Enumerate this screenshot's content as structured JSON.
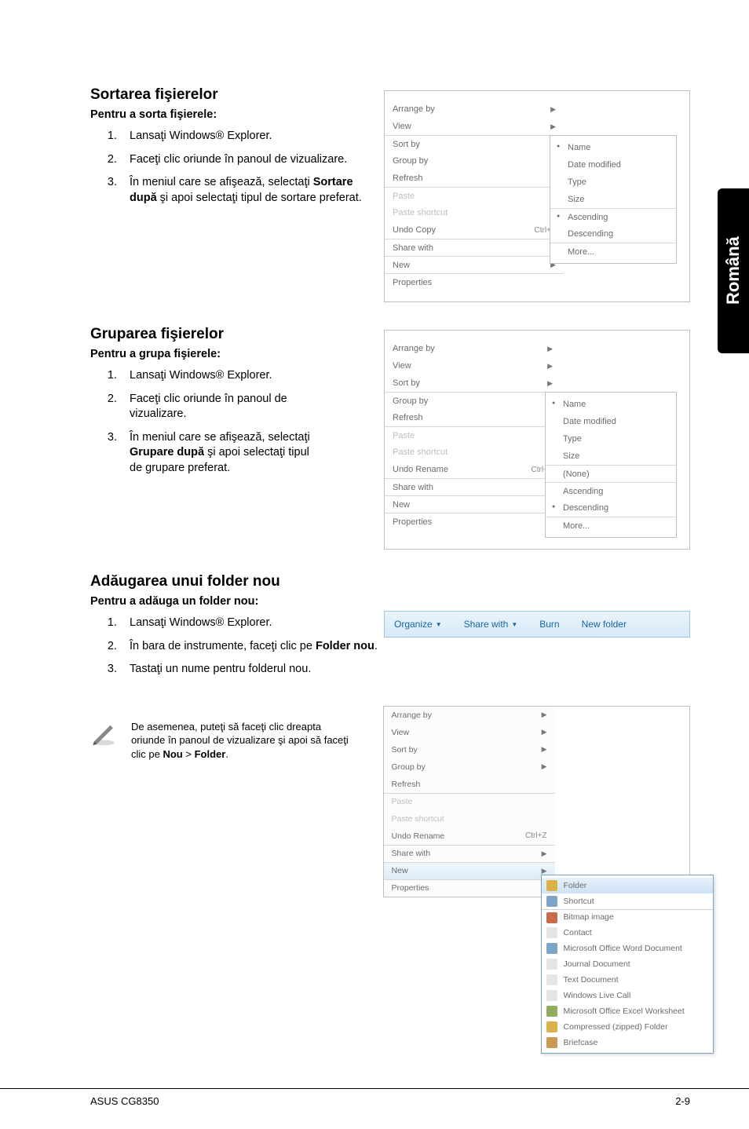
{
  "side_tab": "Română",
  "section1": {
    "title": "Sortarea fişierelor",
    "sub": "Pentru a sorta fişierele:",
    "steps": {
      "s1": "Lansaţi Windows® Explorer.",
      "s2": "Faceţi clic oriunde în panoul de vizualizare.",
      "s3_a": "În meniul care se afişează, selectaţi ",
      "s3_b": "Sortare după",
      "s3_c": " şi apoi selectaţi tipul de sortare preferat."
    },
    "menu": {
      "arrange": "Arrange by",
      "view": "View",
      "sort": "Sort by",
      "group": "Group by",
      "refresh": "Refresh",
      "paste": "Paste",
      "paste_sc": "Paste shortcut",
      "undo": "Undo Copy",
      "undo_key": "Ctrl+Z",
      "share": "Share with",
      "new": "New",
      "props": "Properties",
      "sub": {
        "name": "Name",
        "date": "Date modified",
        "type": "Type",
        "size": "Size",
        "asc": "Ascending",
        "desc": "Descending",
        "more": "More..."
      }
    }
  },
  "section2": {
    "title": "Gruparea fişierelor",
    "sub": "Pentru a grupa fişierele:",
    "steps": {
      "s1": "Lansaţi Windows® Explorer.",
      "s2": "Faceţi clic oriunde în panoul de vizualizare.",
      "s3_a": "În meniul care se afişează, selectaţi ",
      "s3_b": "Grupare după",
      "s3_c": " şi apoi selectaţi tipul de grupare preferat."
    },
    "menu": {
      "arrange": "Arrange by",
      "view": "View",
      "sort": "Sort by",
      "group": "Group by",
      "refresh": "Refresh",
      "paste": "Paste",
      "paste_sc": "Paste shortcut",
      "undo": "Undo Rename",
      "undo_key": "Ctrl+Z",
      "share": "Share with",
      "new": "New",
      "props": "Properties",
      "sub": {
        "name": "Name",
        "date": "Date modified",
        "type": "Type",
        "size": "Size",
        "none": "(None)",
        "asc": "Ascending",
        "desc": "Descending",
        "more": "More..."
      }
    }
  },
  "section3": {
    "title": "Adăugarea unui folder nou",
    "sub": "Pentru a adăuga un folder nou:",
    "steps": {
      "s1": "Lansaţi Windows® Explorer.",
      "s2_a": "În bara de instrumente, faceţi clic pe ",
      "s2_b": "Folder nou",
      "s2_c": ".",
      "s3": "Tastaţi un nume pentru folderul nou."
    },
    "toolbar": {
      "organize": "Organize",
      "share": "Share with",
      "burn": "Burn",
      "newfolder": "New folder"
    },
    "tip": {
      "a": "De asemenea, puteţi să faceţi clic dreapta oriunde în panoul de vizualizare şi apoi să faceţi clic pe ",
      "b": "Nou",
      "c": " > ",
      "d": "Folder",
      "e": "."
    },
    "menu": {
      "arrange": "Arrange by",
      "view": "View",
      "sort": "Sort by",
      "group": "Group by",
      "refresh": "Refresh",
      "paste": "Paste",
      "paste_sc": "Paste shortcut",
      "undo": "Undo Rename",
      "undo_key": "Ctrl+Z",
      "share": "Share with",
      "new": "New",
      "props": "Properties",
      "sub": {
        "folder": "Folder",
        "shortcut": "Shortcut",
        "bmp": "Bitmap image",
        "contact": "Contact",
        "word": "Microsoft Office Word Document",
        "journal": "Journal Document",
        "text": "Text Document",
        "live": "Windows Live Call",
        "excel": "Microsoft Office Excel Worksheet",
        "zip": "Compressed (zipped) Folder",
        "brief": "Briefcase"
      }
    }
  },
  "footer": {
    "left": "ASUS CG8350",
    "right": "2-9"
  }
}
